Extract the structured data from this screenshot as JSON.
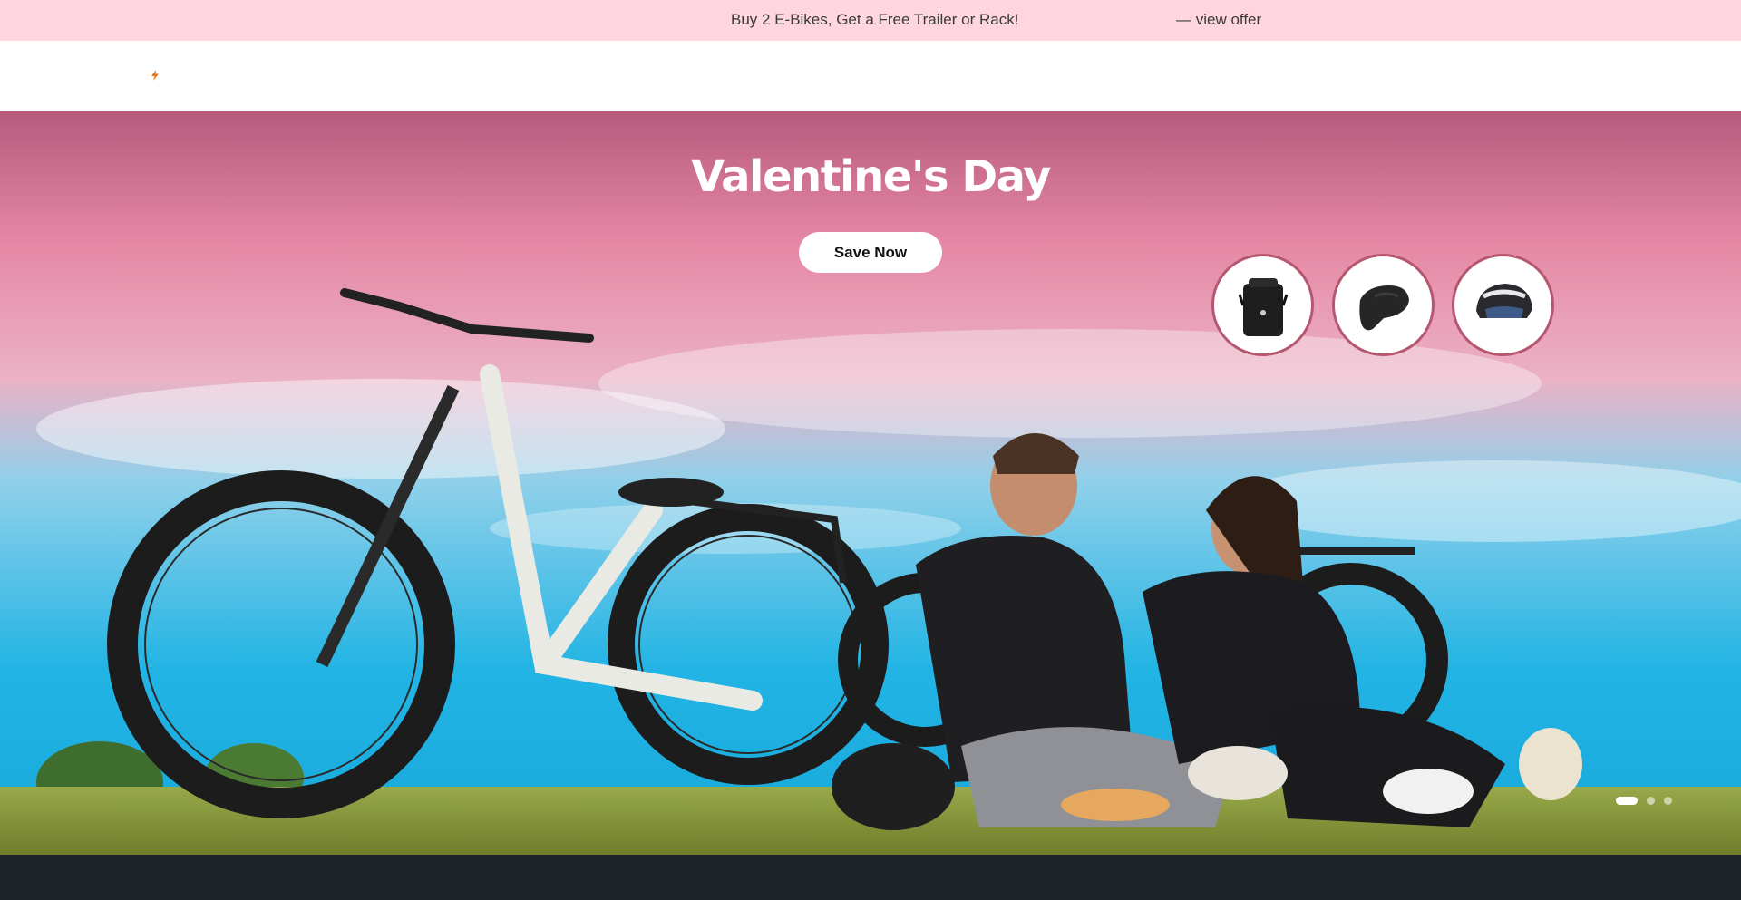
{
  "announcement": {
    "message": "Buy 2 E-Bikes, Get a Free Trailer or Rack!",
    "link_text": "— view offer",
    "background": "#ffd6df"
  },
  "header": {
    "logo_icon": "bolt-icon"
  },
  "hero": {
    "title": "Valentine's Day",
    "cta_label": "Save Now",
    "accessories": [
      {
        "name": "pannier-bag",
        "icon": "bag-icon"
      },
      {
        "name": "saddle",
        "icon": "saddle-icon"
      },
      {
        "name": "helmet",
        "icon": "helmet-icon"
      }
    ],
    "slides": {
      "count": 3,
      "active": 1
    }
  },
  "colors": {
    "sky_top": "#c56582",
    "sky_bottom": "#1ab0e0",
    "grass": "#8aa23a",
    "accent_ring": "#b4576f",
    "footer": "#1d2228"
  }
}
